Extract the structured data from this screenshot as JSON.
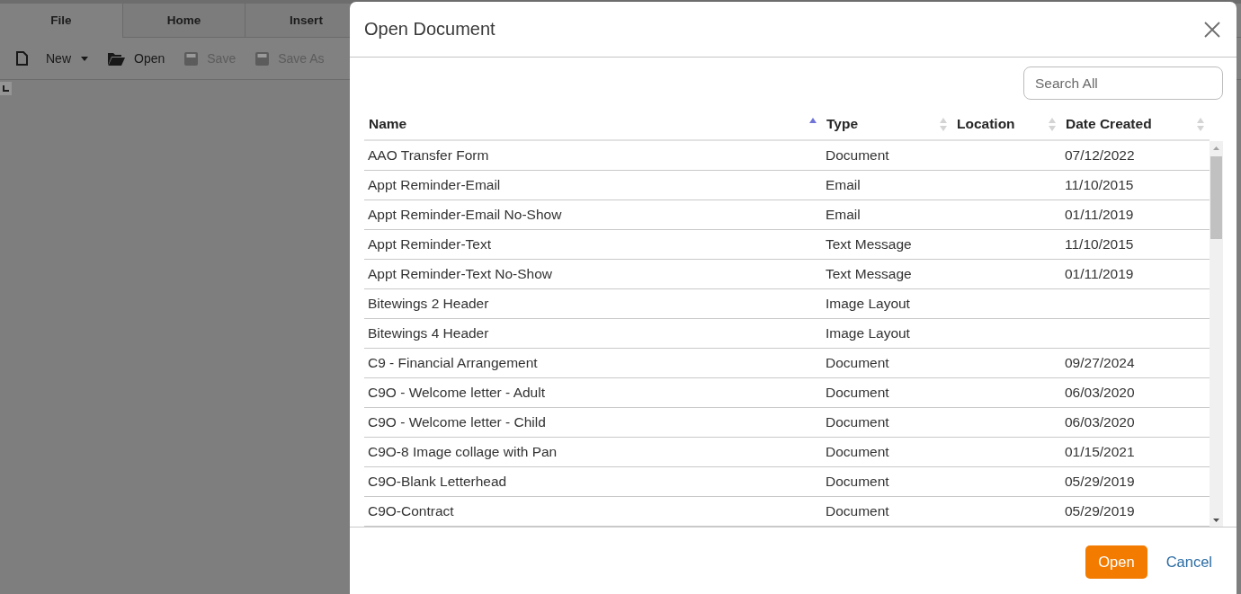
{
  "app": {
    "tabs": [
      {
        "label": "File",
        "selected": true
      },
      {
        "label": "Home",
        "selected": false
      },
      {
        "label": "Insert",
        "selected": false
      }
    ],
    "toolbar": [
      {
        "label": "New",
        "disabled": false,
        "has_menu": true
      },
      {
        "label": "Open",
        "disabled": false,
        "has_menu": false
      },
      {
        "label": "Save",
        "disabled": true,
        "has_menu": false
      },
      {
        "label": "Save As",
        "disabled": true,
        "has_menu": false
      }
    ]
  },
  "dialog": {
    "title": "Open Document",
    "search": {
      "placeholder": "Search All"
    },
    "table": {
      "columns": [
        {
          "label": "Name",
          "sorted": true
        },
        {
          "label": "Type",
          "sorted": false
        },
        {
          "label": "Location",
          "sorted": false
        },
        {
          "label": "Date Created",
          "sorted": false
        }
      ],
      "rows": [
        {
          "name": "AAO Transfer Form",
          "type": "Document",
          "date_created": "07/12/2022"
        },
        {
          "name": "Appt Reminder-Email",
          "type": "Email",
          "date_created": "11/10/2015"
        },
        {
          "name": "Appt Reminder-Email No-Show",
          "type": "Email",
          "date_created": "01/11/2019"
        },
        {
          "name": "Appt Reminder-Text",
          "type": "Text Message",
          "date_created": "11/10/2015"
        },
        {
          "name": "Appt Reminder-Text No-Show",
          "type": "Text Message",
          "date_created": "01/11/2019"
        },
        {
          "name": "Bitewings 2 Header",
          "type": "Image Layout"
        },
        {
          "name": "Bitewings 4 Header",
          "type": "Image Layout"
        },
        {
          "name": "C9 - Financial Arrangement",
          "type": "Document",
          "date_created": "09/27/2024"
        },
        {
          "name": "C9O - Welcome letter - Adult",
          "type": "Document",
          "date_created": "06/03/2020"
        },
        {
          "name": "C9O - Welcome letter - Child",
          "type": "Document",
          "date_created": "06/03/2020"
        },
        {
          "name": "C9O-8 Image collage with Pan",
          "type": "Document",
          "date_created": "01/15/2021"
        },
        {
          "name": "C9O-Blank Letterhead",
          "type": "Document",
          "date_created": "05/29/2019"
        },
        {
          "name": "C9O-Contract",
          "type": "Document",
          "date_created": "05/29/2019"
        }
      ]
    },
    "buttons": [
      {
        "label": "Open",
        "kind": "primary"
      },
      {
        "label": "Cancel",
        "kind": "link"
      }
    ]
  }
}
